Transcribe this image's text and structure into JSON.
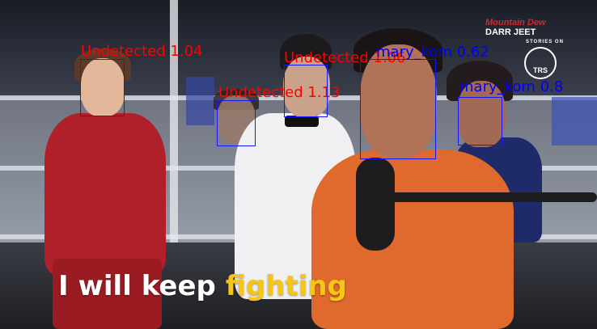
{
  "detections": [
    {
      "label": "Undetected",
      "score": "1.04",
      "color": "#ff0000"
    },
    {
      "label": "Undetected",
      "score": "1.13",
      "color": "#ff0000"
    },
    {
      "label": "Undetected",
      "score": "1.06",
      "color": "#ff0000"
    },
    {
      "label": "mary_kom",
      "score": "0.62",
      "color": "#0000ff"
    },
    {
      "label": "mary_kom",
      "score": "0.8",
      "color": "#0000ff"
    }
  ],
  "caption": {
    "plain": "I will keep",
    "highlight": "fighting",
    "highlight_color": "#f5c518"
  },
  "brand": {
    "line1": "Mountain Dew",
    "line2": "DARR",
    "line3": "JEET",
    "line4": "STORIES ON"
  },
  "channel_logo": "TRS"
}
